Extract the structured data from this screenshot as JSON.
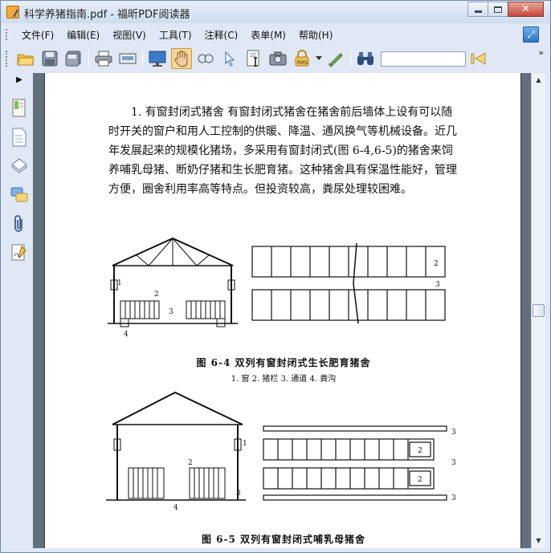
{
  "window": {
    "title": "科学养猪指南.pdf - 福昕PDF阅读器"
  },
  "menu": [
    "文件(F)",
    "编辑(E)",
    "视图(V)",
    "工具(T)",
    "注释(C)",
    "表单(M)",
    "帮助(H)"
  ],
  "toolbar": {
    "overflow": "»",
    "search_value": ""
  },
  "document": {
    "paragraph": "1. 有窗封闭式猪舍 有窗封闭式猪舍在猪舍前后墙体上设有可以随时开关的窗户和用人工控制的供暖、降温、通风换气等机械设备。近几年发展起来的规模化猪场，多采用有窗封闭式(图 6-4,6-5)的猪舍来饲养哺乳母猪、断奶仔猪和生长肥育猪。这种猪舍具有保温性能好，管理方便，圈舍利用率高等特点。但投资较高，粪尿处理较困难。",
    "fig1_caption": "图 6-4  双列有窗封闭式生长肥育猪舍",
    "fig1_legend": "1. 窗  2. 猪栏  3. 通道  4. 粪沟",
    "fig2_caption": "图 6-5  双列有窗封闭式哺乳母猪舍",
    "fig1_labels": {
      "l1": "1",
      "l2": "2",
      "l3": "3",
      "l4": "4",
      "p2": "2",
      "p3": "3"
    },
    "fig2_labels": {
      "l1": "1",
      "l2": "2",
      "l3": "3",
      "l4": "4",
      "p2a": "2",
      "p2b": "2",
      "p3a": "3",
      "p3b": "3",
      "p3c": "3"
    }
  }
}
